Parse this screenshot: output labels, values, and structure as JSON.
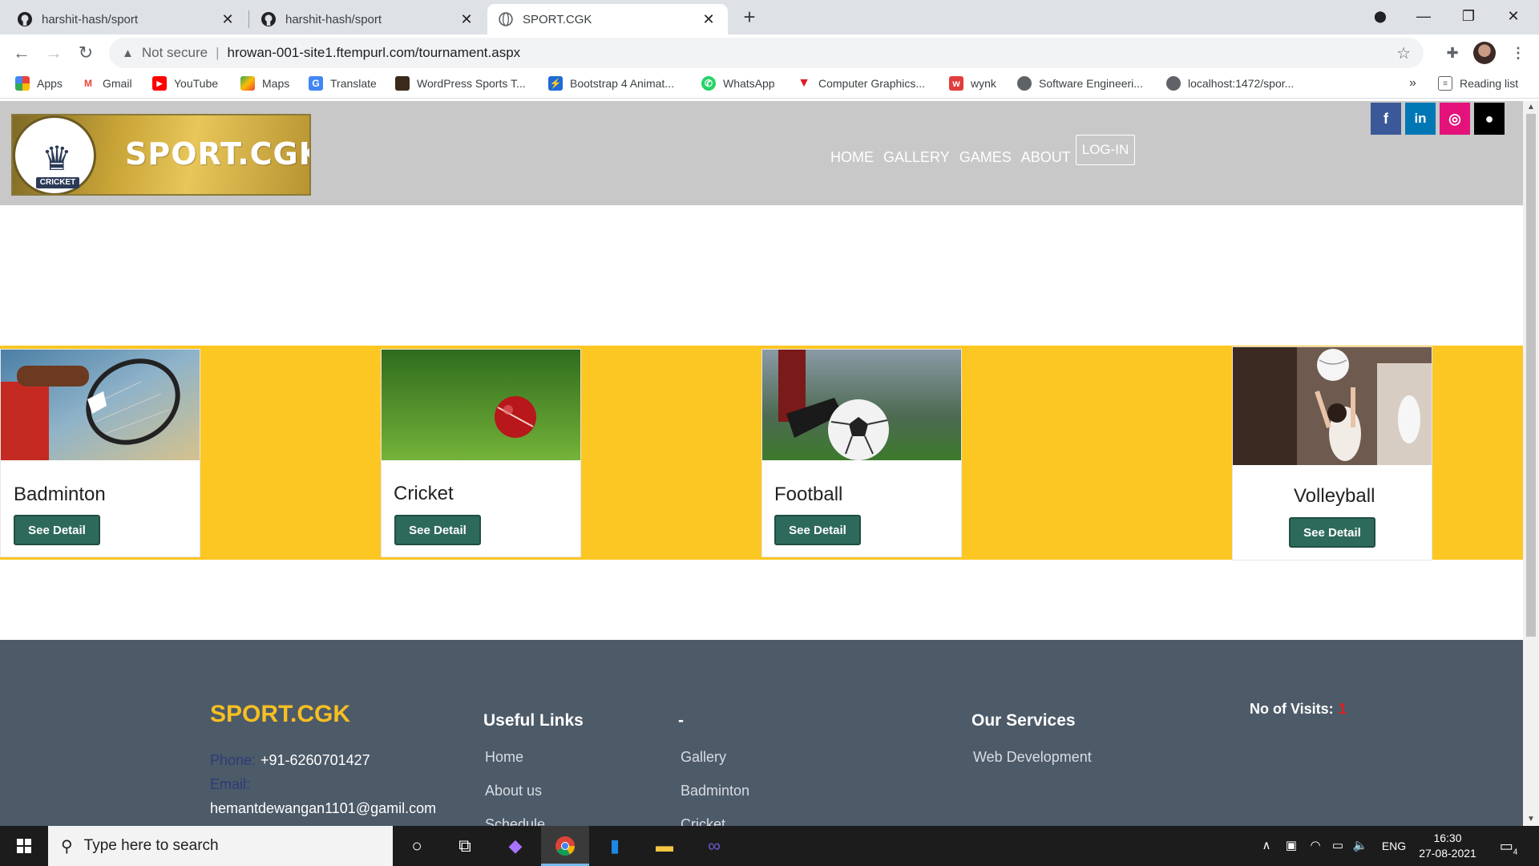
{
  "browser": {
    "tabs": [
      {
        "label": "harshit-hash/sport",
        "icon": "github-icon"
      },
      {
        "label": "harshit-hash/sport",
        "icon": "github-icon"
      },
      {
        "label": "SPORT.CGK",
        "icon": "globe-icon"
      }
    ],
    "address": {
      "security": "Not secure",
      "url": "hrowan-001-site1.ftempurl.com/tournament.aspx"
    },
    "bookmarks": [
      {
        "label": "Apps",
        "icon": "apps-grid-icon",
        "color": "#ea4335"
      },
      {
        "label": "Gmail",
        "icon": "gmail-icon",
        "color": "#ea4335"
      },
      {
        "label": "YouTube",
        "icon": "youtube-icon",
        "color": "#ff0000"
      },
      {
        "label": "Maps",
        "icon": "maps-icon",
        "color": "#34a853"
      },
      {
        "label": "Translate",
        "icon": "translate-icon",
        "color": "#4285f4"
      },
      {
        "label": "WordPress Sports T...",
        "icon": "wordpress-icon",
        "color": "#3b2a1a"
      },
      {
        "label": "Bootstrap 4 Animat...",
        "icon": "bootstrap-icon",
        "color": "#1e6ad6"
      },
      {
        "label": "WhatsApp",
        "icon": "whatsapp-icon",
        "color": "#25d366"
      },
      {
        "label": "Computer Graphics...",
        "icon": "triangle-icon",
        "color": "#e01b24"
      },
      {
        "label": "wynk",
        "icon": "wynk-icon",
        "color": "#e23c3c"
      },
      {
        "label": "Software Engineeri...",
        "icon": "globe-icon",
        "color": "#5f6368"
      },
      {
        "label": "localhost:1472/spor...",
        "icon": "globe-icon",
        "color": "#5f6368"
      }
    ],
    "more": "»",
    "reading_list": "Reading list"
  },
  "site": {
    "logo_text": "SPORT.CGK",
    "logo_badge": "CRICKET",
    "nav": [
      "HOME",
      "GALLERY",
      "GAMES",
      "ABOUT"
    ],
    "login": "LOG-IN",
    "social": [
      {
        "label": "f",
        "color": "#3b5998",
        "icon": "facebook-icon"
      },
      {
        "label": "in",
        "color": "#0077b5",
        "icon": "linkedin-icon"
      },
      {
        "label": "◎",
        "color": "#e4127a",
        "icon": "instagram-icon"
      },
      {
        "label": "●",
        "color": "#000000",
        "icon": "github-icon"
      }
    ],
    "cards": [
      {
        "title": "Badminton",
        "button": "See Detail"
      },
      {
        "title": "Cricket",
        "button": "See Detail"
      },
      {
        "title": "Football",
        "button": "See Detail"
      },
      {
        "title": "Volleyball",
        "button": "See Detail"
      }
    ],
    "footer": {
      "brand": "SPORT.CGK",
      "phone_label": "Phone:",
      "phone": "+91-6260701427",
      "email_label": "Email:",
      "email": "hemantdewangan1101@gamil.com",
      "useful_links_title": "Useful Links",
      "useful_links": [
        "Home",
        "About us",
        "Schedule"
      ],
      "second_title": "-",
      "second_links": [
        "Gallery",
        "Badminton",
        "Cricket"
      ],
      "services_title": "Our Services",
      "services": [
        "Web Development"
      ],
      "visits_label": "No of Visits:",
      "visits_count": "1"
    }
  },
  "taskbar": {
    "search_placeholder": "Type here to search",
    "language": "ENG",
    "time": "16:30",
    "date": "27-08-2021",
    "notification_count": "4"
  },
  "colors": {
    "accent_yellow": "#fcc623",
    "button_green": "#2e6a5c",
    "footer_bg": "#4d5a68",
    "brand_gold": "#f6bf22"
  }
}
